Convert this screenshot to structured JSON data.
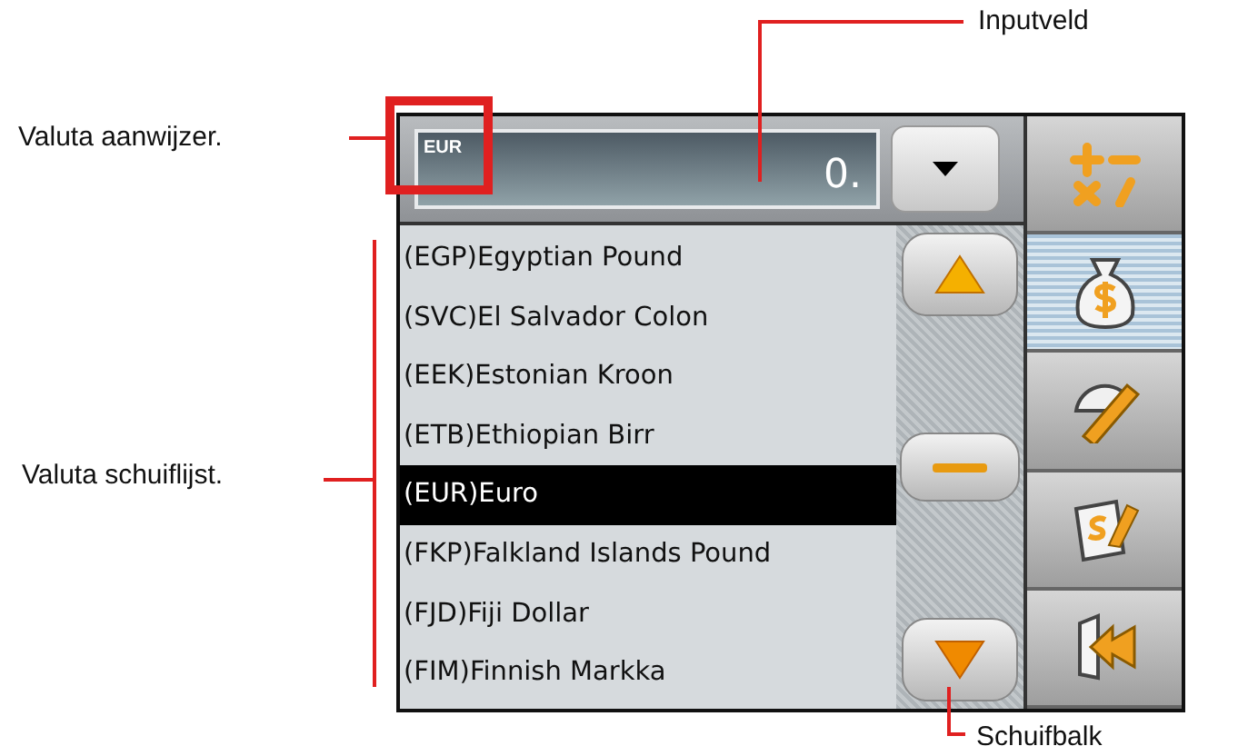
{
  "annotations": [
    {
      "kind": "indicator",
      "text": "Valuta aanwijzer."
    },
    {
      "kind": "input",
      "text": "Inputveld"
    },
    {
      "kind": "list",
      "text": "Valuta schuiflijst."
    },
    {
      "kind": "scrollbar",
      "text": "Schuifbalk"
    }
  ],
  "currency_indicator": "EUR",
  "input": {
    "value": "0."
  },
  "currencies": [
    {
      "label": "(EGP)Egyptian Pound",
      "selected": false
    },
    {
      "label": "(SVC)El Salvador Colon",
      "selected": false
    },
    {
      "label": "(EEK)Estonian Kroon",
      "selected": false
    },
    {
      "label": "(ETB)Ethiopian Birr",
      "selected": false
    },
    {
      "label": "(EUR)Euro",
      "selected": true
    },
    {
      "label": "(FKP)Falkland Islands Pound",
      "selected": false
    },
    {
      "label": "(FJD)Fiji Dollar",
      "selected": false
    },
    {
      "label": "(FIM)Finnish Markka",
      "selected": false
    }
  ],
  "side_buttons": [
    {
      "kind": "calculator",
      "selected": false
    },
    {
      "kind": "currency",
      "selected": true
    },
    {
      "kind": "measure",
      "selected": false
    },
    {
      "kind": "rates",
      "selected": false
    },
    {
      "kind": "exit",
      "selected": false
    }
  ]
}
